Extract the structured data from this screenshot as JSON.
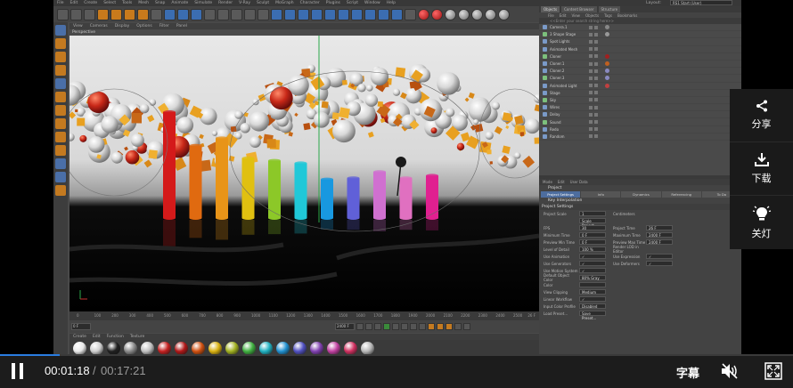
{
  "player": {
    "current_time": "00:01:18",
    "separator": "/",
    "total_time": "00:17:21",
    "progress": 0.075,
    "subtitle_label": "字幕",
    "accent_color": "#2a7de1"
  },
  "share_panel": {
    "items": [
      {
        "label": "分享",
        "icon": "share-icon"
      },
      {
        "label": "下载",
        "icon": "download-icon"
      },
      {
        "label": "关灯",
        "icon": "bulb-icon"
      }
    ]
  },
  "c4d": {
    "menu": [
      "File",
      "Edit",
      "Create",
      "Select",
      "Tools",
      "Mesh",
      "Snap",
      "Animate",
      "Simulate",
      "Render",
      "V-Ray",
      "Sculpt",
      "MoGraph",
      "Character",
      "Plugins",
      "Script",
      "Window",
      "Help"
    ],
    "layout_label": "Layout:",
    "layout_value": "RS1 Start (User)",
    "viewport_menu": [
      "View",
      "Cameras",
      "Display",
      "Options",
      "Filter",
      "Panel"
    ],
    "viewport_title": "Perspective",
    "timeline_ticks": [
      "0",
      "100",
      "200",
      "300",
      "400",
      "500",
      "600",
      "700",
      "800",
      "900",
      "1000",
      "1100",
      "1200",
      "1300",
      "1400",
      "1500",
      "1600",
      "1700",
      "1800",
      "1900",
      "2000",
      "2100",
      "2200",
      "2300",
      "2400",
      "2500"
    ],
    "timeline_end": "26 F",
    "frame_fields": [
      "0 F",
      "0 F",
      "2400 F",
      "2400 F"
    ],
    "material_menu": [
      "Create",
      "Edit",
      "Function",
      "Texture"
    ],
    "material_colors": [
      "#e8e8e8",
      "#cfcfcf",
      "#202020",
      "#8a8a8a",
      "#c0c0c0",
      "#c42020",
      "#b01818",
      "#d05010",
      "#d8b010",
      "#a0b020",
      "#40b040",
      "#20b0c0",
      "#2090d0",
      "#5050c0",
      "#8040b0",
      "#c040a0",
      "#d03060",
      "#b8b8b8"
    ],
    "right_tabs": [
      "Objects",
      "Content Browser",
      "Structure"
    ],
    "object_menu": [
      "File",
      "Edit",
      "View",
      "Objects",
      "Tags",
      "Bookmarks"
    ],
    "search_placeholder": "<<Enter your search string here>>",
    "objects": [
      {
        "name": "Camera.1",
        "tag": "#888888"
      },
      {
        "name": "3 Shape Stage",
        "tag": "#999999"
      },
      {
        "name": "Spot Lights",
        "tag": ""
      },
      {
        "name": "Animated Mesh",
        "tag": ""
      },
      {
        "name": "Cloner",
        "tag": "#a02020"
      },
      {
        "name": "Cloner.1",
        "tag": "#c06020"
      },
      {
        "name": "Cloner.2",
        "tag": "#8a8ac0"
      },
      {
        "name": "Cloner.3",
        "tag": "#8a8ac0"
      },
      {
        "name": "Animated Light",
        "tag": "#c04040"
      },
      {
        "name": "Stage",
        "tag": ""
      },
      {
        "name": "Sky",
        "tag": ""
      },
      {
        "name": "Wires",
        "tag": ""
      },
      {
        "name": "Delay",
        "tag": ""
      },
      {
        "name": "Sound",
        "tag": ""
      },
      {
        "name": "Redo",
        "tag": ""
      },
      {
        "name": "Random",
        "tag": ""
      }
    ],
    "attr_menu": [
      "Mode",
      "Edit",
      "User Data"
    ],
    "attr_title": "Project",
    "attr_tabs": [
      "Project Settings",
      "Info",
      "Dynamics",
      "Referencing",
      "To Do"
    ],
    "attr_sub": "Key Interpolation",
    "attr_head": "Project Settings",
    "attr_rows": [
      {
        "l1": "Project Scale",
        "v1": "1",
        "l2": "Centimeters",
        "v2": ""
      },
      {
        "l1": "",
        "v1": "Scale Project...",
        "l2": "",
        "v2": ""
      },
      {
        "l1": "FPS",
        "v1": "30",
        "l2": "Project Time",
        "v2": "26 F"
      },
      {
        "l1": "Minimum Time",
        "v1": "0 F",
        "l2": "Maximum Time",
        "v2": "2400 F"
      },
      {
        "l1": "Preview Min Time",
        "v1": "0 F",
        "l2": "Preview Max Time",
        "v2": "2400 F"
      },
      {
        "l1": "Level of Detail",
        "v1": "100 %",
        "l2": "Render LOD in Editor",
        "v2": ""
      },
      {
        "l1": "Use Animation",
        "v1": "✓",
        "l2": "Use Expression",
        "v2": "✓"
      },
      {
        "l1": "Use Generators",
        "v1": "✓",
        "l2": "Use Deformers",
        "v2": "✓"
      },
      {
        "l1": "Use Motion System",
        "v1": "✓",
        "l2": "",
        "v2": ""
      },
      {
        "l1": "Default Object Color",
        "v1": "80% Gray",
        "l2": "",
        "v2": ""
      },
      {
        "l1": "Color",
        "v1": "",
        "l2": "",
        "v2": ""
      },
      {
        "l1": "View Clipping",
        "v1": "Medium",
        "l2": "",
        "v2": ""
      },
      {
        "l1": "Linear Workflow",
        "v1": "✓",
        "l2": "",
        "v2": ""
      },
      {
        "l1": "Input Color Profile",
        "v1": "Disabled",
        "l2": "",
        "v2": ""
      },
      {
        "l1": "Load Preset...",
        "v1": "Save Preset...",
        "l2": "",
        "v2": ""
      }
    ]
  },
  "scene": {
    "cylinders": [
      {
        "color": "#d41a1a",
        "h": 0.85
      },
      {
        "color": "#e06a10",
        "h": 0.58
      },
      {
        "color": "#e89418",
        "h": 0.64
      },
      {
        "color": "#e0c010",
        "h": 0.48
      },
      {
        "color": "#8cc828",
        "h": 0.46
      },
      {
        "color": "#20c8d8",
        "h": 0.44
      },
      {
        "color": "#1898e0",
        "h": 0.31
      },
      {
        "color": "#6060d8",
        "h": 0.32
      },
      {
        "color": "#d070d0",
        "h": 0.37
      },
      {
        "color": "#e070c0",
        "h": 0.32
      },
      {
        "color": "#e02090",
        "h": 0.34
      }
    ]
  }
}
